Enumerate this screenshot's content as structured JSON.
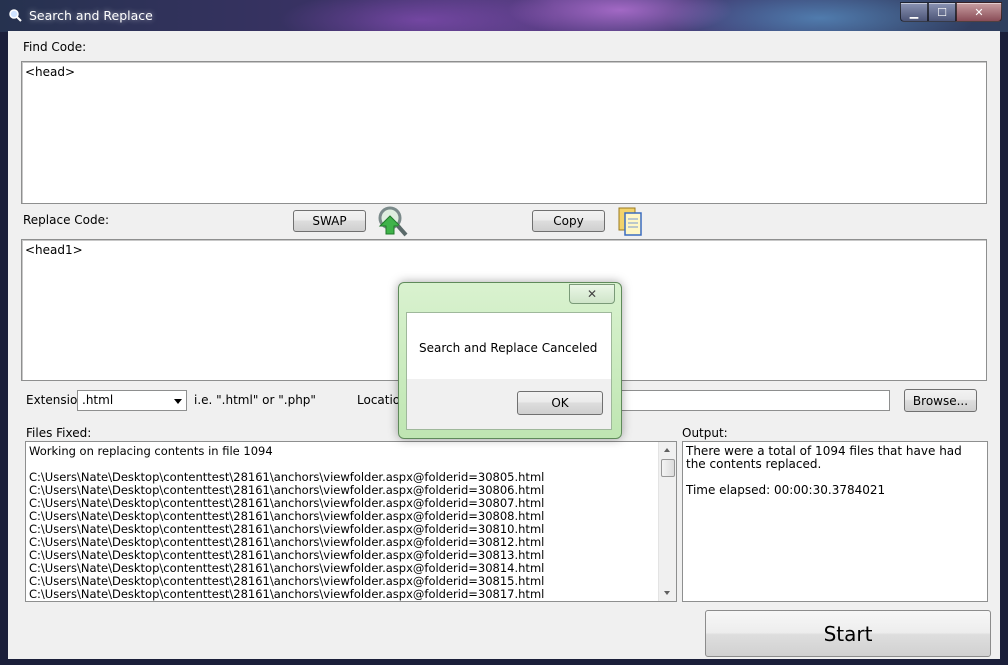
{
  "window": {
    "title": "Search and Replace",
    "controls": {
      "minimize": "▁",
      "maximize": "☐",
      "close": "✕"
    }
  },
  "find": {
    "label": "Find Code:",
    "value": "<head>"
  },
  "replace": {
    "label": "Replace Code:",
    "value": "<head1>",
    "swap_label": "SWAP",
    "copy_label": "Copy"
  },
  "options": {
    "extension_label": "Extension:",
    "extension_value": ".html",
    "hint": "i.e.  \".html\" or \".php\"",
    "location_label": "Location",
    "browse_label": "Browse..."
  },
  "files_fixed": {
    "label": "Files Fixed:",
    "lines": [
      "Working on replacing contents in file 1094",
      "",
      "C:\\Users\\Nate\\Desktop\\contenttest\\28161\\anchors\\viewfolder.aspx@folderid=30805.html",
      "C:\\Users\\Nate\\Desktop\\contenttest\\28161\\anchors\\viewfolder.aspx@folderid=30806.html",
      "C:\\Users\\Nate\\Desktop\\contenttest\\28161\\anchors\\viewfolder.aspx@folderid=30807.html",
      "C:\\Users\\Nate\\Desktop\\contenttest\\28161\\anchors\\viewfolder.aspx@folderid=30808.html",
      "C:\\Users\\Nate\\Desktop\\contenttest\\28161\\anchors\\viewfolder.aspx@folderid=30810.html",
      "C:\\Users\\Nate\\Desktop\\contenttest\\28161\\anchors\\viewfolder.aspx@folderid=30812.html",
      "C:\\Users\\Nate\\Desktop\\contenttest\\28161\\anchors\\viewfolder.aspx@folderid=30813.html",
      "C:\\Users\\Nate\\Desktop\\contenttest\\28161\\anchors\\viewfolder.aspx@folderid=30814.html",
      "C:\\Users\\Nate\\Desktop\\contenttest\\28161\\anchors\\viewfolder.aspx@folderid=30815.html",
      "C:\\Users\\Nate\\Desktop\\contenttest\\28161\\anchors\\viewfolder.aspx@folderid=30817.html"
    ]
  },
  "output": {
    "label": "Output:",
    "line1": "There were a total of 1094 files that have had the contents replaced.",
    "line2": "Time elapsed: 00:00:30.3784021"
  },
  "start_label": "Start",
  "dialog": {
    "message": "Search and Replace Canceled",
    "ok_label": "OK",
    "close_glyph": "✕"
  }
}
